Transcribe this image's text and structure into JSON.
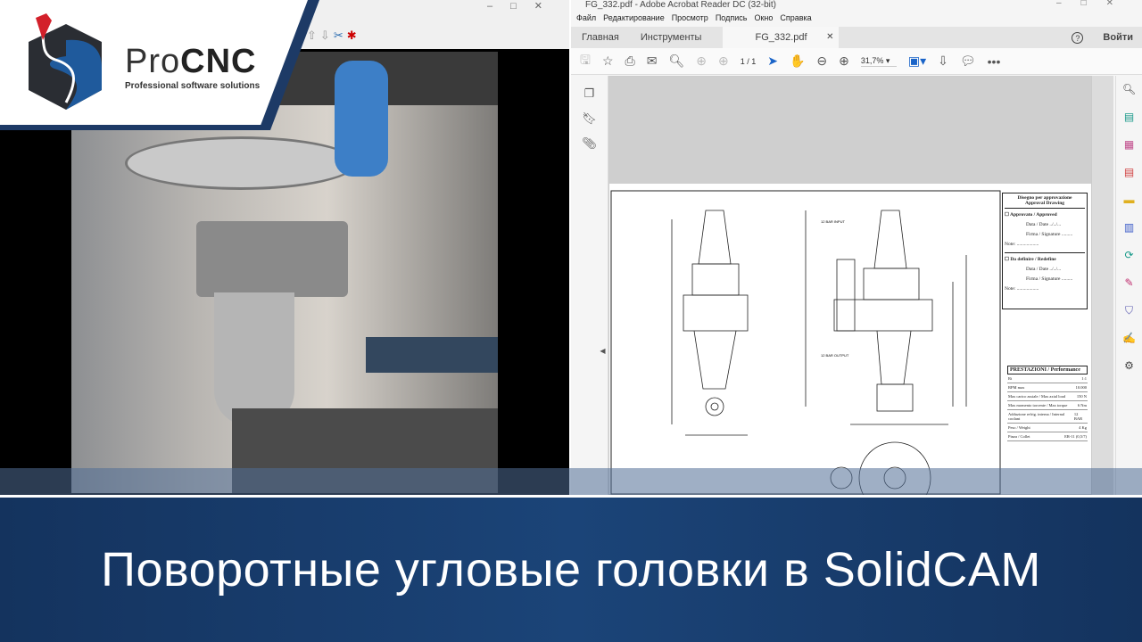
{
  "brand": {
    "name_light": "Pro",
    "name_bold": "CNC",
    "tagline": "Professional software solutions"
  },
  "acrobat": {
    "window_title": "FG_332.pdf - Adobe Acrobat Reader DC (32-bit)",
    "menu": [
      "Файл",
      "Редактирование",
      "Просмотр",
      "Подпись",
      "Окно",
      "Справка"
    ],
    "tabs": {
      "home": "Главная",
      "tools": "Инструменты",
      "document": "FG_332.pdf",
      "signin": "Войти"
    },
    "toolbar": {
      "page_current": "1",
      "page_total": "/ 1",
      "zoom": "31,7%"
    }
  },
  "drawing": {
    "approval": {
      "title1": "Disegno per approvazione",
      "title2": "Approval Drawing",
      "approved": "Approvato / Approved",
      "date": "Data / Date  ../../...",
      "signature": "Firma / Signature  .........",
      "note": "Note: ..................",
      "redefine": "Da definire / Redefine"
    },
    "performance": {
      "title": "PRESTAZIONI / Performance",
      "rows": [
        [
          "Ri",
          "1:1"
        ],
        [
          "RPM max",
          "10.000"
        ],
        [
          "Max carico assiale / Max axial load",
          "150 N"
        ],
        [
          "Max momento torcente / Max torque",
          "6 Nm"
        ],
        [
          "Adduzione refrig. interna / Internal coolant",
          "12 BAR"
        ],
        [
          "Peso / Weight",
          "4 Kg"
        ],
        [
          "Pinza / Collet",
          "ER-11 (0,5/7)"
        ]
      ]
    },
    "labels": {
      "input": "12 BAR INPUT",
      "output": "12 BAR OUTPUT"
    }
  },
  "banner": {
    "title": "Поворотные угловые головки в SolidCAM"
  }
}
